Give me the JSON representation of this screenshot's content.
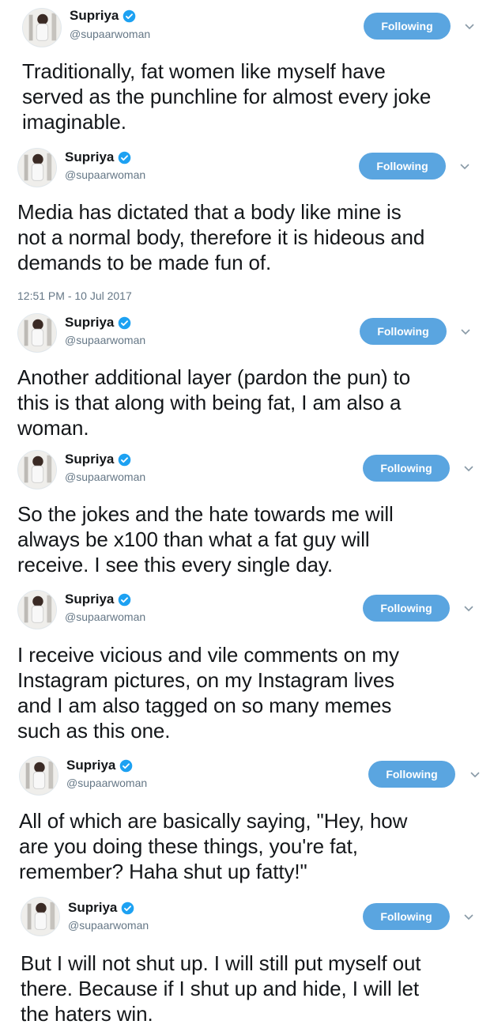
{
  "tweets": [
    {
      "name": "Supriya",
      "handle": "@supaarwoman",
      "follow_label": "Following",
      "lines": [
        "Traditionally, fat women like myself have",
        "served as the punchline for almost every joke",
        "imaginable."
      ]
    },
    {
      "name": "Supriya",
      "handle": "@supaarwoman",
      "follow_label": "Following",
      "lines": [
        "Media has dictated that a body like mine is",
        "not a normal body, therefore it is hideous and",
        "demands to be made fun of."
      ],
      "timestamp": "12:51 PM - 10 Jul 2017"
    },
    {
      "name": "Supriya",
      "handle": "@supaarwoman",
      "follow_label": "Following",
      "lines": [
        "Another additional layer (pardon the pun) to",
        "this is that along with being fat, I am also a",
        "woman."
      ]
    },
    {
      "name": "Supriya",
      "handle": "@supaarwoman",
      "follow_label": "Following",
      "lines": [
        "So the jokes and the hate towards me will",
        "always be x100 than what a fat guy will",
        "receive. I see this every single day."
      ]
    },
    {
      "name": "Supriya",
      "handle": "@supaarwoman",
      "follow_label": "Following",
      "lines": [
        "I receive vicious and vile comments on my",
        "Instagram pictures, on my Instagram lives",
        "and I am also tagged on so many memes",
        "such as this one."
      ]
    },
    {
      "name": "Supriya",
      "handle": "@supaarwoman",
      "follow_label": "Following",
      "lines": [
        "All of which are basically saying, \"Hey, how",
        "are you doing these things, you're fat,",
        "remember? Haha shut up fatty!\""
      ]
    },
    {
      "name": "Supriya",
      "handle": "@supaarwoman",
      "follow_label": "Following",
      "lines": [
        "But I will not shut up. I will still put myself out",
        "there. Because if I shut up and hide, I will let",
        "the haters win."
      ]
    }
  ],
  "colors": {
    "follow_button": "#5aa5e0",
    "verified": "#1da1f2",
    "handle": "#657786"
  },
  "icons": {
    "verified": "verified-badge-icon",
    "menu": "chevron-down-icon"
  }
}
